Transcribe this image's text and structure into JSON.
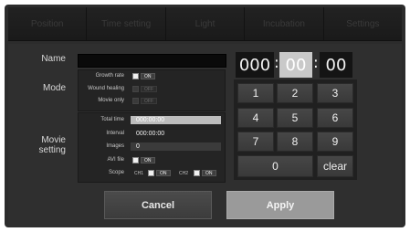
{
  "tabs": [
    "Position",
    "Time setting",
    "Light",
    "Incubation",
    "Settings"
  ],
  "labels": {
    "name": "Name",
    "mode": "Mode",
    "movie_setting": "Movie\nsetting"
  },
  "name_value": "",
  "mode": {
    "growth_rate": {
      "label": "Growth rate",
      "state": "ON",
      "enabled": true
    },
    "wound_healing": {
      "label": "Wound healing",
      "state": "OFF",
      "enabled": false
    },
    "movie_only": {
      "label": "Movie only",
      "state": "OFF",
      "enabled": false
    }
  },
  "movie": {
    "total_time": {
      "label": "Total time",
      "value": "000:00:00"
    },
    "interval": {
      "label": "Interval",
      "value": "000:00:00"
    },
    "images": {
      "label": "Images",
      "value": "0"
    },
    "avi_file": {
      "label": "AVI file",
      "state": "ON"
    },
    "scope": {
      "label": "Scope",
      "ch1": "CH1",
      "ch1_state": "ON",
      "ch2": "CH2",
      "ch2_state": "ON"
    }
  },
  "timer": {
    "hours": "000",
    "minutes": "00",
    "seconds": "00",
    "sep": ":"
  },
  "keypad": {
    "k1": "1",
    "k2": "2",
    "k3": "3",
    "k4": "4",
    "k5": "5",
    "k6": "6",
    "k7": "7",
    "k8": "8",
    "k9": "9",
    "k0": "0",
    "clear": "clear"
  },
  "buttons": {
    "cancel": "Cancel",
    "apply": "Apply"
  }
}
